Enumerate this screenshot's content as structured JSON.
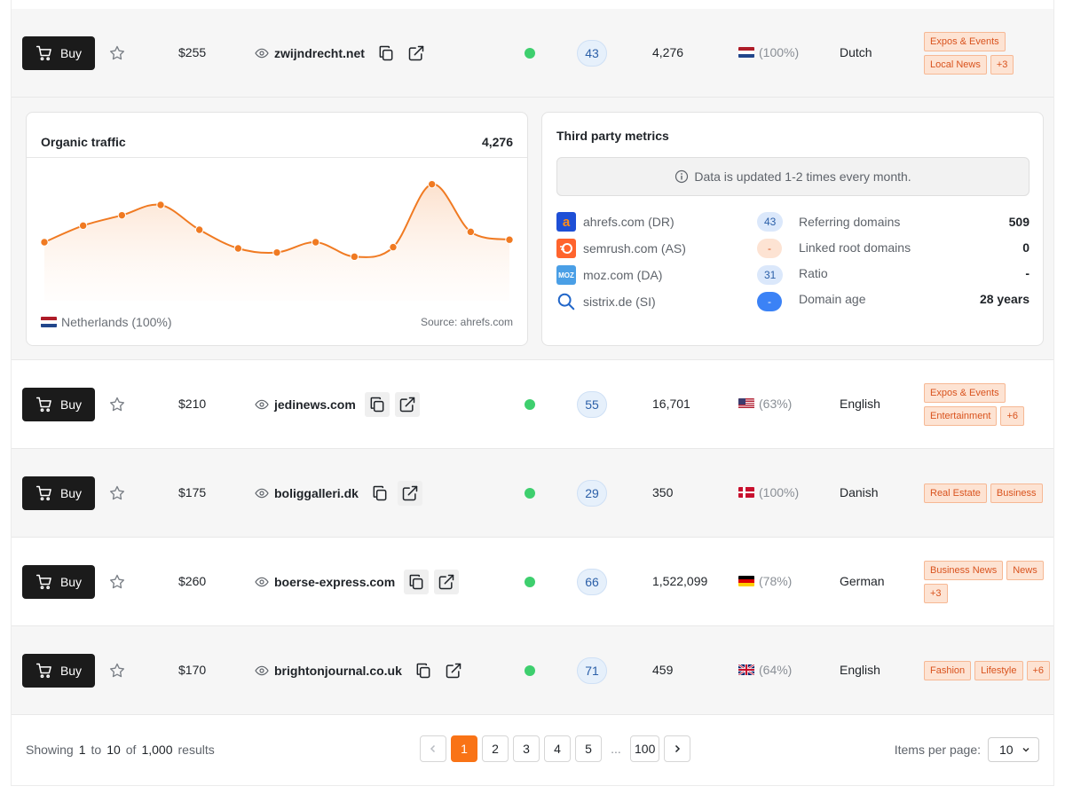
{
  "rows": [
    {
      "buy": "Buy",
      "price": "$255",
      "domain": "zwijndrecht.net",
      "dr": "43",
      "traffic": "4,276",
      "country_pct": "(100%)",
      "flag": "nl",
      "language": "Dutch",
      "tags": [
        "Expos & Events",
        "Local News",
        "+3"
      ]
    },
    {
      "buy": "Buy",
      "price": "$210",
      "domain": "jedinews.com",
      "dr": "55",
      "traffic": "16,701",
      "country_pct": "(63%)",
      "flag": "us",
      "language": "English",
      "tags": [
        "Expos & Events",
        "Entertainment",
        "+6"
      ]
    },
    {
      "buy": "Buy",
      "price": "$175",
      "domain": "boliggalleri.dk",
      "dr": "29",
      "traffic": "350",
      "country_pct": "(100%)",
      "flag": "dk",
      "language": "Danish",
      "tags": [
        "Real Estate",
        "Business"
      ]
    },
    {
      "buy": "Buy",
      "price": "$260",
      "domain": "boerse-express.com",
      "dr": "66",
      "traffic": "1,522,099",
      "country_pct": "(78%)",
      "flag": "de",
      "language": "German",
      "tags": [
        "Business News",
        "News",
        "+3"
      ]
    },
    {
      "buy": "Buy",
      "price": "$170",
      "domain": "brightonjournal.co.uk",
      "dr": "71",
      "traffic": "459",
      "country_pct": "(64%)",
      "flag": "gb",
      "language": "English",
      "tags": [
        "Fashion",
        "Lifestyle",
        "+6"
      ]
    }
  ],
  "details": {
    "organic": {
      "title": "Organic traffic",
      "value": "4,276",
      "country": "Netherlands (100%)",
      "source": "Source: ahrefs.com"
    },
    "third_party": {
      "title": "Third party metrics",
      "notice": "Data is updated 1-2 times every month.",
      "metrics": [
        {
          "label": "ahrefs.com (DR)",
          "value": "43",
          "logo": "a",
          "logo_color": "#1e4fd6",
          "badge_bg": "#dbe8fb",
          "badge_fg": "#2b5fa8"
        },
        {
          "label": "semrush.com (AS)",
          "value": "-",
          "logo": "semrush",
          "logo_color": "#ff642d",
          "badge_bg": "#fde3d3",
          "badge_fg": "#d9531e"
        },
        {
          "label": "moz.com (DA)",
          "value": "31",
          "logo": "MOZ",
          "logo_color": "#4a9fe6",
          "badge_bg": "#dbe8fb",
          "badge_fg": "#2b5fa8"
        },
        {
          "label": "sistrix.de (SI)",
          "value": "-",
          "logo": "sistrix",
          "logo_color": "#2166c9",
          "badge_bg": "#3b82f6",
          "badge_fg": "#ffffff"
        }
      ],
      "stats": [
        {
          "label": "Referring domains",
          "value": "509"
        },
        {
          "label": "Linked root domains",
          "value": "0"
        },
        {
          "label": "Ratio",
          "value": "-"
        },
        {
          "label": "Domain age",
          "value": "28 years"
        }
      ]
    }
  },
  "chart_data": {
    "type": "line",
    "title": "Organic traffic",
    "xlabel": "",
    "ylabel": "",
    "values": [
      3200,
      3600,
      3850,
      4100,
      3500,
      3050,
      2950,
      3200,
      2850,
      3080,
      4600,
      3450,
      3260
    ],
    "ylim": [
      2000,
      5000
    ],
    "grid": false,
    "color": "#f07a22"
  },
  "footer": {
    "showing": "Showing",
    "from": "1",
    "to_word": "to",
    "to": "10",
    "of_word": "of",
    "total": "1,000",
    "results": "results",
    "pages": [
      "1",
      "2",
      "3",
      "4",
      "5"
    ],
    "ellipsis": "...",
    "last_page": "100",
    "items_per_page_label": "Items per page:",
    "items_per_page": "10"
  },
  "colors": {
    "accent": "#f97316",
    "status_green": "#3ecf6e"
  }
}
